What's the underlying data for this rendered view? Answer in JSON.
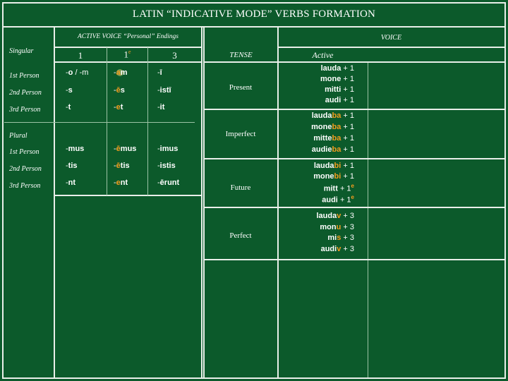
{
  "title": "LATIN “INDICATIVE MODE” VERBS FORMATION",
  "left_panel": {
    "header": "ACTIVE VOICE “Personal” Endings",
    "singular_label": "Singular",
    "plural_label": "Plural",
    "persons": [
      "1st Person",
      "2nd Person",
      "3rd Person"
    ],
    "columns": [
      {
        "num": "1",
        "sup": ""
      },
      {
        "num": "1",
        "sup": "e"
      },
      {
        "num": "3",
        "sup": ""
      }
    ],
    "singular_rows": [
      [
        {
          "pre": "",
          "ora": "",
          "post": "o"
        },
        {
          "pre": "-",
          "ora": "a",
          "post": "m"
        },
        {
          "pre": "-",
          "ora": "",
          "post": "ī"
        }
      ],
      [
        {
          "pre": "-",
          "ora": "",
          "post": "s"
        },
        {
          "pre": "-",
          "ora": "ē",
          "post": "s"
        },
        {
          "pre": "-",
          "ora": "",
          "post": "istī"
        }
      ],
      [
        {
          "pre": "-",
          "ora": "",
          "post": "t"
        },
        {
          "pre": "-",
          "ora": "e",
          "post": "t"
        },
        {
          "pre": "-",
          "ora": "",
          "post": "it"
        }
      ]
    ],
    "singular_first_extra": "/ -m",
    "plural_rows": [
      [
        {
          "pre": "-",
          "ora": "",
          "post": "mus"
        },
        {
          "pre": "-",
          "ora": "ē",
          "post": "mus"
        },
        {
          "pre": "-",
          "ora": "",
          "post": "imus"
        }
      ],
      [
        {
          "pre": "-",
          "ora": "",
          "post": "tis"
        },
        {
          "pre": "-",
          "ora": "ē",
          "post": "tis"
        },
        {
          "pre": "-",
          "ora": "",
          "post": "istis"
        }
      ],
      [
        {
          "pre": "-",
          "ora": "",
          "post": "nt"
        },
        {
          "pre": "-",
          "ora": "e",
          "post": "nt"
        },
        {
          "pre": "-",
          "ora": "",
          "post": "ērunt"
        }
      ]
    ]
  },
  "right_panel": {
    "voice_label": "VOICE",
    "tense_label": "TENSE",
    "active_label": "Active",
    "tenses": [
      {
        "name": "Present",
        "verbs": [
          {
            "stem": "lauda",
            "mid": "",
            "plus": "+ 1",
            "sup": ""
          },
          {
            "stem": "mone",
            "mid": "",
            "plus": "+ 1",
            "sup": ""
          },
          {
            "stem": "mitti",
            "mid": "",
            "plus": "+ 1",
            "sup": ""
          },
          {
            "stem": "audi",
            "mid": "",
            "plus": "+ 1",
            "sup": ""
          }
        ]
      },
      {
        "name": "Imperfect",
        "verbs": [
          {
            "stem": "lauda",
            "mid": "ba",
            "plus": "+ 1",
            "sup": ""
          },
          {
            "stem": "mone",
            "mid": "ba",
            "plus": "+ 1",
            "sup": ""
          },
          {
            "stem": "mitte",
            "mid": "ba",
            "plus": "+ 1",
            "sup": ""
          },
          {
            "stem": "audie",
            "mid": "ba",
            "plus": "+ 1",
            "sup": ""
          }
        ]
      },
      {
        "name": "Future",
        "verbs": [
          {
            "stem": "lauda",
            "mid": "bi",
            "plus": "+ 1",
            "sup": ""
          },
          {
            "stem": "mone",
            "mid": "bi",
            "plus": "+ 1",
            "sup": ""
          },
          {
            "stem": "mitt",
            "mid": "",
            "plus": "+ 1",
            "sup": "e"
          },
          {
            "stem": "audi",
            "mid": "",
            "plus": "+ 1",
            "sup": "e"
          }
        ]
      },
      {
        "name": "Perfect",
        "verbs": [
          {
            "stem": "lauda",
            "mid": "v",
            "plus": "+ 3",
            "sup": ""
          },
          {
            "stem": "mon",
            "mid": "u",
            "plus": "+ 3",
            "sup": ""
          },
          {
            "stem": "mi",
            "mid": "s",
            "plus": "+ 3",
            "sup": ""
          },
          {
            "stem": "audi",
            "mid": "v",
            "plus": "+ 3",
            "sup": ""
          }
        ]
      }
    ]
  },
  "colors": {
    "background": "#0c5a2b",
    "lines": "#e9efe9",
    "accent": "#f39c1f"
  }
}
